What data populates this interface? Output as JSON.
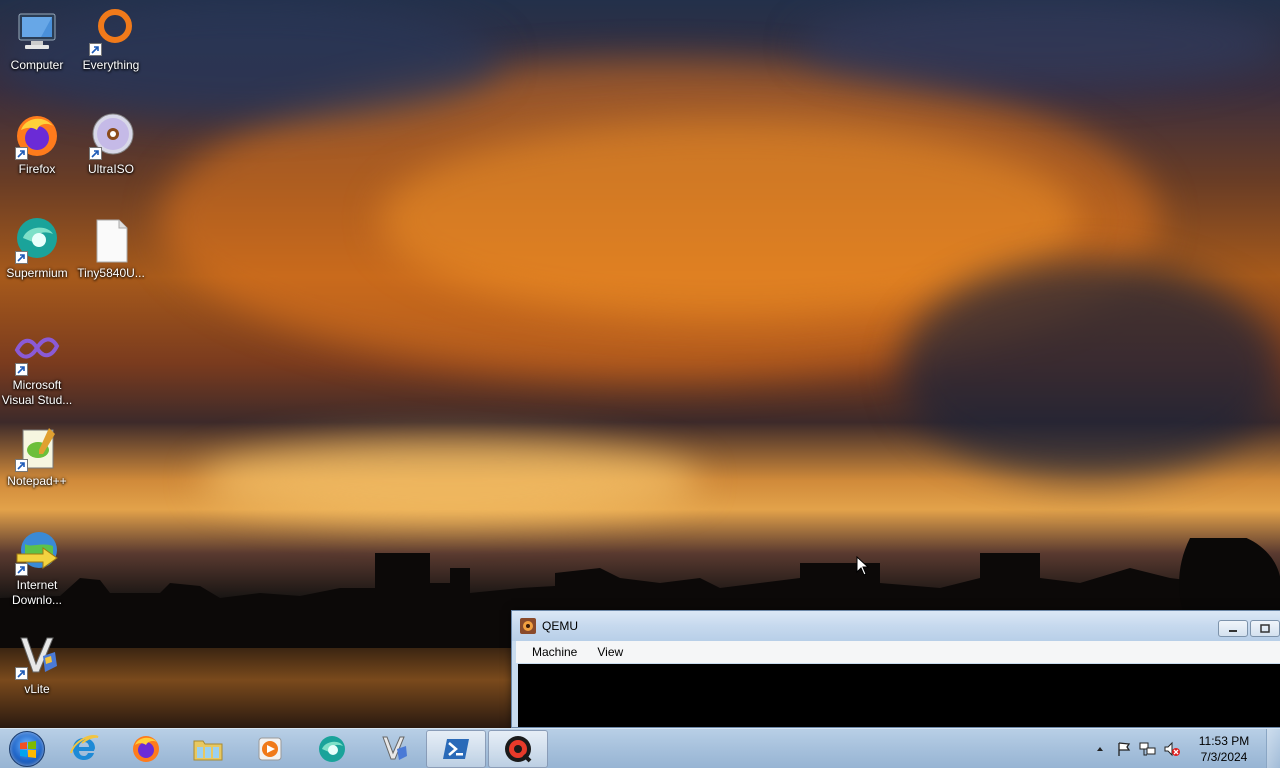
{
  "desktop": {
    "icons": [
      {
        "label": "Computer"
      },
      {
        "label": "Everything"
      },
      {
        "label": "Firefox"
      },
      {
        "label": "UltraISO"
      },
      {
        "label": "Supermium"
      },
      {
        "label": "Tiny5840U..."
      },
      {
        "label": "Microsoft Visual Stud..."
      },
      {
        "label": "Notepad++"
      },
      {
        "label": "Internet Downlo..."
      },
      {
        "label": "vLite"
      }
    ]
  },
  "qemu_window": {
    "title": "QEMU",
    "menu": [
      "Machine",
      "View"
    ]
  },
  "taskbar": {
    "pinned": [
      "Internet Explorer",
      "Firefox",
      "Windows Explorer",
      "Media Player",
      "Supermium",
      "vLite",
      "PowerShell",
      "QEMU"
    ],
    "clock": {
      "time": "11:53 PM",
      "date": "7/3/2024"
    }
  },
  "colors": {
    "taskbar": "#a8c2dd",
    "window_title": "#c6d9ee",
    "qemu_screen": "#000000"
  }
}
